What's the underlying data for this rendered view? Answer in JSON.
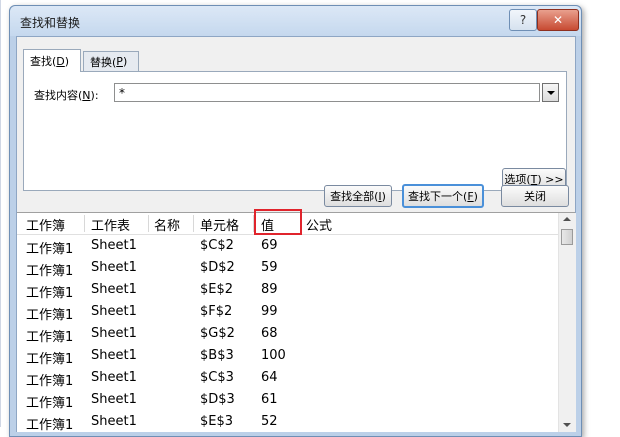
{
  "dialog": {
    "title": "查找和替换",
    "help_label": "?",
    "close_label": "✕"
  },
  "tabs": {
    "find": {
      "label": "查找(",
      "key": "D",
      "suffix": ")"
    },
    "replace": {
      "label": "替换(",
      "key": "P",
      "suffix": ")"
    }
  },
  "find": {
    "label_prefix": "查找内容(",
    "label_key": "N",
    "label_suffix": "):",
    "value": "*"
  },
  "buttons": {
    "options": {
      "label": "选项(",
      "key": "T",
      "suffix": ") >>"
    },
    "find_all": {
      "label": "查找全部(",
      "key": "I",
      "suffix": ")"
    },
    "find_next": {
      "label": "查找下一个(",
      "key": "F",
      "suffix": ")"
    },
    "close": {
      "label": "关闭"
    }
  },
  "results": {
    "columns": [
      "工作簿",
      "工作表",
      "名称",
      "单元格",
      "值",
      "公式"
    ],
    "rows": [
      [
        "工作簿1",
        "Sheet1",
        "",
        "$C$2",
        "69",
        ""
      ],
      [
        "工作簿1",
        "Sheet1",
        "",
        "$D$2",
        "59",
        ""
      ],
      [
        "工作簿1",
        "Sheet1",
        "",
        "$E$2",
        "89",
        ""
      ],
      [
        "工作簿1",
        "Sheet1",
        "",
        "$F$2",
        "99",
        ""
      ],
      [
        "工作簿1",
        "Sheet1",
        "",
        "$G$2",
        "68",
        ""
      ],
      [
        "工作簿1",
        "Sheet1",
        "",
        "$B$3",
        "100",
        ""
      ],
      [
        "工作簿1",
        "Sheet1",
        "",
        "$C$3",
        "64",
        ""
      ],
      [
        "工作簿1",
        "Sheet1",
        "",
        "$D$3",
        "61",
        ""
      ],
      [
        "工作簿1",
        "Sheet1",
        "",
        "$E$3",
        "52",
        ""
      ]
    ]
  },
  "colors": {
    "highlight_box": "#e0242c",
    "title_bar": "#c5d8ee",
    "close_button": "#c74a32"
  }
}
